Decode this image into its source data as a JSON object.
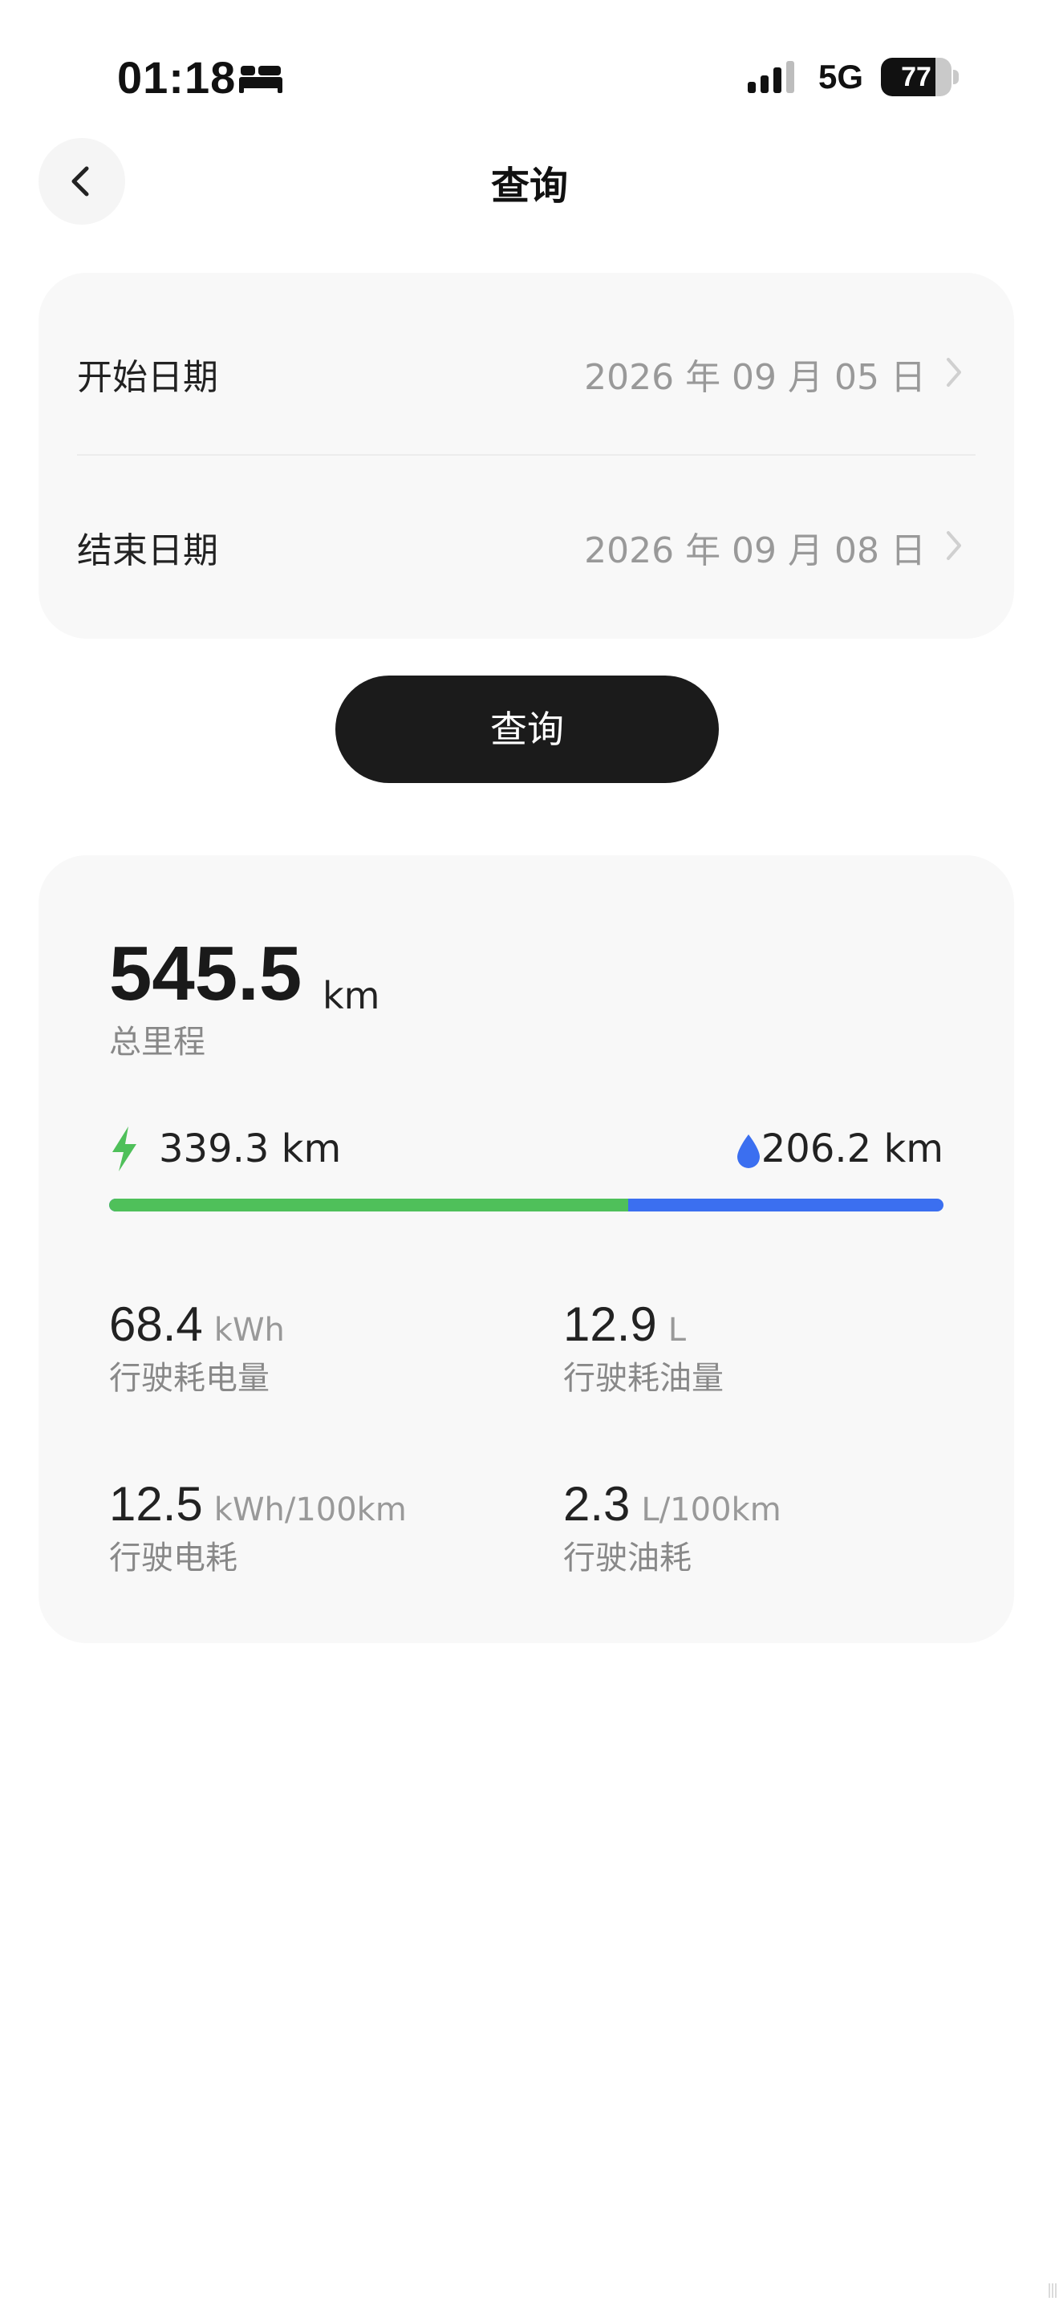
{
  "status_bar": {
    "time": "01:18",
    "network": "5G",
    "battery_level": "77",
    "battery_fraction": 0.77,
    "icons": [
      "sleep-icon",
      "signal-icon",
      "battery-icon"
    ]
  },
  "header": {
    "title": "查询",
    "back_icon": "chevron-left-icon"
  },
  "date_range": {
    "start": {
      "label": "开始日期",
      "value": "2026 年 09 月 05 日"
    },
    "end": {
      "label": "结束日期",
      "value": "2026 年 09 月 08 日"
    }
  },
  "query_button": {
    "label": "查询"
  },
  "summary": {
    "total_mileage": {
      "value": "545.5",
      "unit": "km",
      "label": "总里程"
    },
    "electric": {
      "value": "339.3 km",
      "icon": "lightning-icon",
      "color": "#4fc05a"
    },
    "fuel": {
      "value": "206.2 km",
      "icon": "water-drop-icon",
      "color": "#3b6ff0"
    },
    "electric_fraction": 0.622,
    "metrics": [
      {
        "value": "68.4",
        "unit": "kWh",
        "label": "行驶耗电量"
      },
      {
        "value": "12.9",
        "unit": "L",
        "label": "行驶耗油量"
      },
      {
        "value": "12.5",
        "unit": "kWh/100km",
        "label": "行驶电耗"
      },
      {
        "value": "2.3",
        "unit": "L/100km",
        "label": "行驶油耗"
      }
    ]
  }
}
